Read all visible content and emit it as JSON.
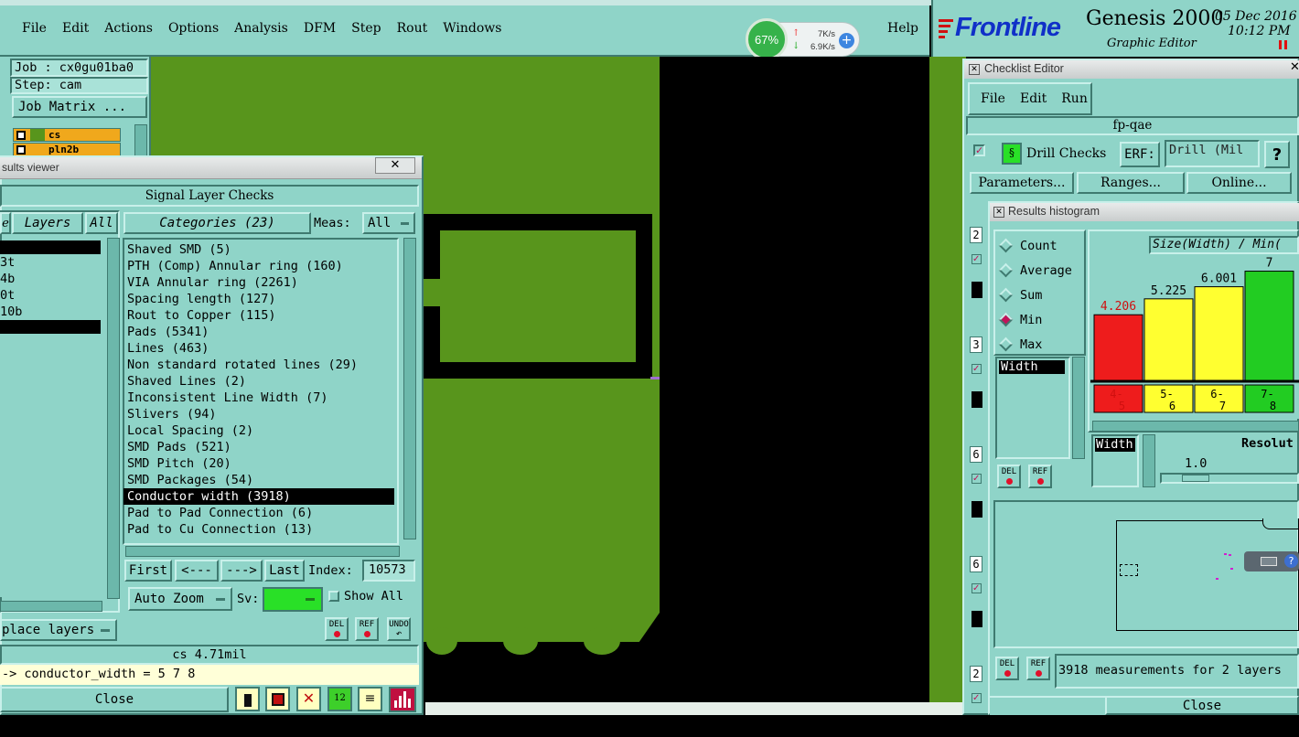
{
  "menubar": {
    "items": [
      "File",
      "Edit",
      "Actions",
      "Options",
      "Analysis",
      "DFM",
      "Step",
      "Rout",
      "Windows"
    ],
    "help": "Help"
  },
  "net_widget": {
    "percent": "67%",
    "up": "7K/s",
    "down": "6.9K/s"
  },
  "brand": {
    "logo": "Frontline",
    "product": "Genesis 2000",
    "subtitle": "Graphic Editor",
    "date": "05 Dec 2016",
    "time": "10:12 PM"
  },
  "job_panel": {
    "job": "Job : cx0gu01ba0",
    "step": "Step: cam",
    "matrix_button": "Job Matrix ...",
    "layers": [
      "cs",
      "pln2b"
    ]
  },
  "results_viewer": {
    "title": "sults viewer",
    "header": "Signal Layer Checks",
    "layers_label": "Layers",
    "all_label": "All",
    "layer_items": [
      "",
      "3t",
      "4b",
      "0t",
      "10b",
      ""
    ],
    "categories_label": "Categories (23)",
    "meas_label": "Meas:",
    "meas_value": "All",
    "categories": [
      "Shaved SMD (5)",
      "PTH (Comp) Annular ring (160)",
      "VIA Annular ring (2261)",
      "Spacing length (127)",
      "Rout to Copper (115)",
      "Pads (5341)",
      "Lines (463)",
      "Non standard rotated lines (29)",
      "Shaved Lines (2)",
      "Inconsistent Line Width (7)",
      "Slivers (94)",
      "Local Spacing (2)",
      "SMD Pads (521)",
      "SMD Pitch (20)",
      "SMD Packages (54)",
      "Conductor width (3918)",
      "Pad to Pad Connection (6)",
      "Pad to Cu Connection (13)"
    ],
    "selected_category": "Conductor width (3918)",
    "nav": {
      "first": "First",
      "prev": "<---",
      "next": "--->",
      "last": "Last",
      "index_label": "Index:",
      "index_value": "10573"
    },
    "auto_zoom": "Auto Zoom",
    "sv_label": "Sv:",
    "show_all": "Show All",
    "place_layers": "place layers",
    "status": "cs 4.71mil",
    "expression": "-> conductor_width = 5 7 8",
    "close": "Close",
    "small_buttons": [
      "DEL",
      "REF",
      "UNDO"
    ]
  },
  "checklist_editor": {
    "title": "Checklist Editor",
    "menu": [
      "File",
      "Edit",
      "Run"
    ],
    "name": "fp-qae",
    "check_name": "Drill Checks",
    "erf_label": "ERF:",
    "erf_value": "Drill (Mil",
    "help_mark": "?",
    "buttons": [
      "Parameters...",
      "Ranges...",
      "Online..."
    ],
    "row_numbers": [
      "2",
      "3",
      "6",
      "6",
      "2"
    ]
  },
  "histogram": {
    "title": "Results histogram",
    "modes": [
      "Count",
      "Average",
      "Sum",
      "Min",
      "Max"
    ],
    "selected_mode": "Min",
    "header": "Size(Width) / Min(",
    "field_top": "Width",
    "field_bottom": "Width",
    "resolution_label": "Resolut",
    "resolution_value": "1.0",
    "status": "3918 measurements for 2 layers",
    "close": "Close"
  },
  "chart_data": {
    "type": "bar",
    "categories": [
      "4-5",
      "5-6",
      "6-7",
      "7-8"
    ],
    "values": [
      4.206,
      5.225,
      6.001,
      7
    ],
    "value_labels": [
      "4.206",
      "5.225",
      "6.001",
      "7"
    ],
    "colors": [
      "#ee1c1c",
      "#ffff30",
      "#ffff30",
      "#22cc22"
    ],
    "label_colors": [
      "#d01010",
      "#000000",
      "#000000",
      "#000000"
    ],
    "ylim": [
      0,
      7.5
    ]
  }
}
